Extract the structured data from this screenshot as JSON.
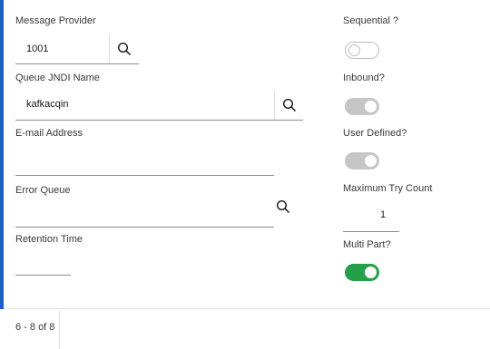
{
  "form": {
    "message_provider": {
      "label": "Message Provider",
      "value": "1001"
    },
    "queue_jndi_name": {
      "label": "Queue JNDI Name",
      "value": "kafkacqin"
    },
    "email_address": {
      "label": "E-mail Address",
      "value": ""
    },
    "error_queue": {
      "label": "Error Queue",
      "value": ""
    },
    "retention_time": {
      "label": "Retention Time",
      "value": ""
    },
    "sequential": {
      "label": "Sequential ?",
      "state": "off"
    },
    "inbound": {
      "label": "Inbound?",
      "state": "on-disabled"
    },
    "user_defined": {
      "label": "User Defined?",
      "state": "on-disabled"
    },
    "maximum_try_count": {
      "label": "Maximum Try Count",
      "value": "1"
    },
    "multi_part": {
      "label": "Multi Part?",
      "state": "on"
    }
  },
  "pagination": {
    "text": "6 - 8 of 8"
  },
  "icons": {
    "search": "search-icon"
  },
  "colors": {
    "accent": "#1f5cc8",
    "toggle_on": "#24a148",
    "toggle_disabled": "#c6c6c6"
  }
}
